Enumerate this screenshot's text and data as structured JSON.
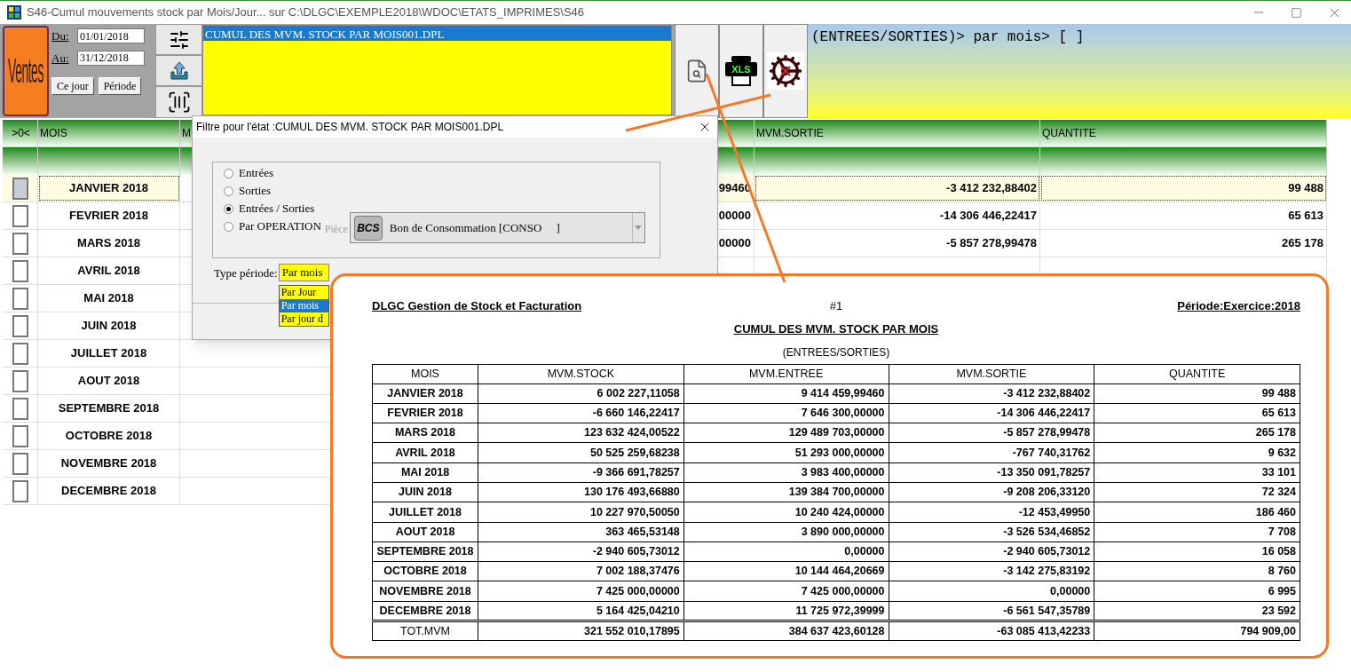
{
  "window": {
    "title": "S46-Cumul mouvements stock par Mois/Jour... sur C:\\DLGC\\EXEMPLE2018\\WDOC\\ETATS_IMPRIMES\\S46"
  },
  "toolbar": {
    "module_button": "Ventes",
    "date_from": {
      "label": "Du:",
      "value": "01/01/2018"
    },
    "date_to": {
      "label": "Au:",
      "value": "31/12/2018"
    },
    "buttons": [
      "Ce jour",
      "Période"
    ],
    "report_list": [
      {
        "label": "CUMUL DES MVM. STOCK PAR MOIS001.DPL",
        "selected": true
      }
    ],
    "export_badge": "XLS",
    "breadcrumb": "(ENTREES/SORTIES)> par mois> [ ]"
  },
  "grid": {
    "headers": [
      ">0<",
      "MOIS",
      "M",
      "MVM.SORTIE",
      "QUANTITE"
    ],
    "rows": [
      {
        "month": "JANVIER 2018",
        "entree": "99460",
        "sortie": "-3 412 232,88402",
        "quantite": "99 488",
        "selected": true
      },
      {
        "month": "FEVRIER 2018",
        "entree": "00000",
        "sortie": "-14 306 446,22417",
        "quantite": "65 613",
        "selected": false
      },
      {
        "month": "MARS 2018",
        "entree": "00000",
        "sortie": "-5 857 278,99478",
        "quantite": "265 178",
        "selected": false
      },
      {
        "month": "AVRIL 2018",
        "selected": false
      },
      {
        "month": "MAI 2018",
        "selected": false
      },
      {
        "month": "JUIN 2018",
        "selected": false
      },
      {
        "month": "JUILLET 2018",
        "selected": false
      },
      {
        "month": "AOUT 2018",
        "selected": false
      },
      {
        "month": "SEPTEMBRE 2018",
        "selected": false
      },
      {
        "month": "OCTOBRE 2018",
        "selected": false
      },
      {
        "month": "NOVEMBRE 2018",
        "selected": false
      },
      {
        "month": "DECEMBRE 2018",
        "selected": false
      }
    ]
  },
  "dialog": {
    "title": "Filtre pour l'état :CUMUL DES MVM. STOCK PAR MOIS001.DPL",
    "options": [
      {
        "label": "Entrées",
        "selected": false
      },
      {
        "label": "Sorties",
        "selected": false
      },
      {
        "label": "Entrées / Sorties",
        "selected": true
      },
      {
        "label": "Par OPERATION",
        "selected": false
      }
    ],
    "piece": {
      "label": "Pièce",
      "disabled": true,
      "badge": "BCS",
      "value": "Bon de Consommation [CONSO     ]"
    },
    "period": {
      "label": "Type période:",
      "value": "Par mois",
      "options": [
        {
          "label": "Par Jour",
          "selected": false
        },
        {
          "label": "Par mois",
          "selected": true
        },
        {
          "label": "Par jour d",
          "selected": false
        }
      ]
    }
  },
  "report": {
    "company": "DLGC Gestion de Stock et Facturation",
    "page": "#1",
    "period": "Période:Exercice:2018",
    "title": "CUMUL DES MVM. STOCK PAR MOIS",
    "subtitle": "(ENTREES/SORTIES)",
    "columns": [
      "MOIS",
      "MVM.STOCK",
      "MVM.ENTREE",
      "MVM.SORTIE",
      "QUANTITE"
    ],
    "rows": [
      [
        "JANVIER 2018",
        "6 002 227,11058",
        "9 414 459,99460",
        "-3 412 232,88402",
        "99 488"
      ],
      [
        "FEVRIER 2018",
        "-6 660 146,22417",
        "7 646 300,00000",
        "-14 306 446,22417",
        "65 613"
      ],
      [
        "MARS 2018",
        "123 632 424,00522",
        "129 489 703,00000",
        "-5 857 278,99478",
        "265 178"
      ],
      [
        "AVRIL 2018",
        "50 525 259,68238",
        "51 293 000,00000",
        "-767 740,31762",
        "9 632"
      ],
      [
        "MAI 2018",
        "-9 366 691,78257",
        "3 983 400,00000",
        "-13 350 091,78257",
        "33 101"
      ],
      [
        "JUIN 2018",
        "130 176 493,66880",
        "139 384 700,00000",
        "-9 208 206,33120",
        "72 324"
      ],
      [
        "JUILLET 2018",
        "10 227 970,50050",
        "10 240 424,00000",
        "-12 453,49950",
        "186 460"
      ],
      [
        "AOUT 2018",
        "363 465,53148",
        "3 890 000,00000",
        "-3 526 534,46852",
        "7 708"
      ],
      [
        "SEPTEMBRE 2018",
        "-2 940 605,73012",
        "0,00000",
        "-2 940 605,73012",
        "16 058"
      ],
      [
        "OCTOBRE 2018",
        "7 002 188,37476",
        "10 144 464,20669",
        "-3 142 275,83192",
        "8 760"
      ],
      [
        "NOVEMBRE 2018",
        "7 425 000,00000",
        "7 425 000,00000",
        "0,00000",
        "6 995"
      ],
      [
        "DECEMBRE 2018",
        "5 164 425,04210",
        "11 725 972,39999",
        "-6 561 547,35789",
        "23 592"
      ]
    ],
    "total": [
      "TOT.MVM",
      "321 552 010,17895",
      "384 637 423,60128",
      "-63 085 413,42233",
      "794 909,00"
    ]
  }
}
